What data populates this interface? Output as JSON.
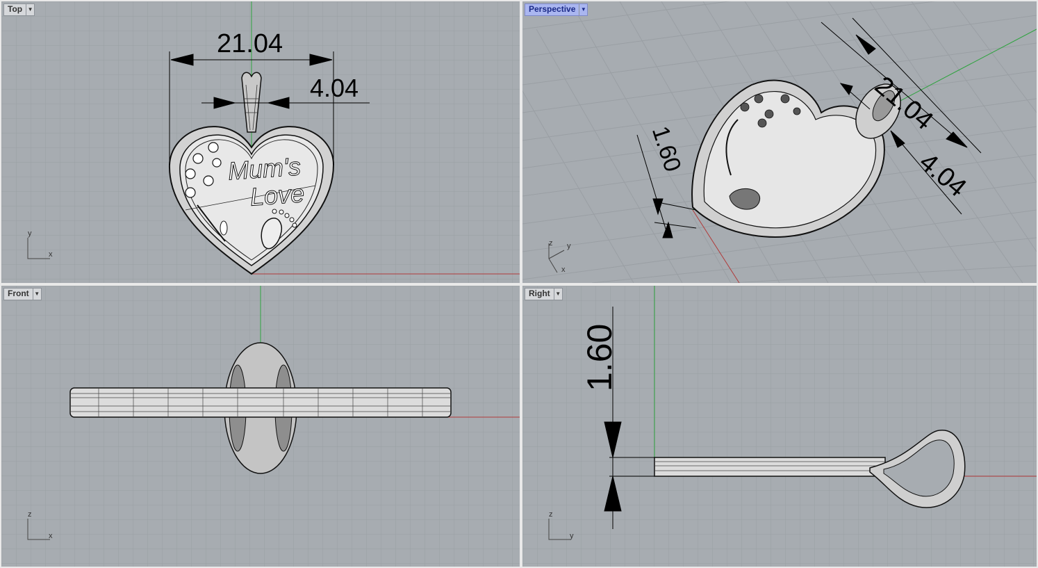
{
  "viewports": {
    "top": {
      "label": "Top",
      "axis": {
        "v": "y",
        "h": "x"
      },
      "dims": {
        "width": "21.04",
        "bail": "4.04"
      },
      "text": {
        "line1": "Mum's",
        "line2": "Love"
      }
    },
    "perspective": {
      "label": "Perspective",
      "active": true,
      "axis": {
        "a": "z",
        "b": "y",
        "c": "x"
      },
      "dims": {
        "width": "21.04",
        "bail": "4.04",
        "thickness": "1.60"
      }
    },
    "front": {
      "label": "Front",
      "axis": {
        "v": "z",
        "h": "x"
      }
    },
    "right": {
      "label": "Right",
      "axis": {
        "v": "z",
        "h": "y"
      },
      "dims": {
        "thickness": "1.60"
      }
    }
  },
  "colors": {
    "viewport_bg": "#a7acb1",
    "grid": "#9a9fa4",
    "grid_major": "#8f949a",
    "x_axis": "#b03a3a",
    "y_axis": "#2fa33f",
    "active_label": "#aab6f0"
  },
  "icons": {
    "dropdown": "chevron-down-icon"
  }
}
